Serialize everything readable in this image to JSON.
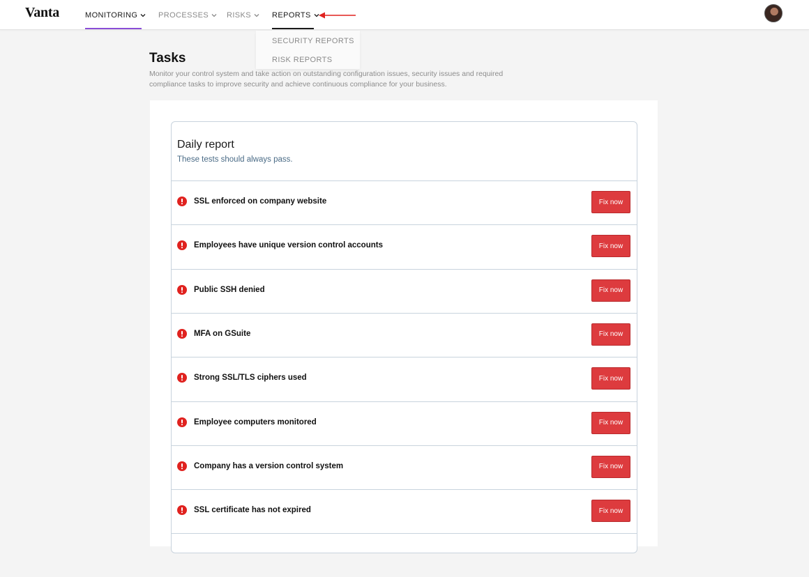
{
  "brand": {
    "logo": "Vanta"
  },
  "nav": {
    "items": [
      {
        "label": "MONITORING",
        "active": true
      },
      {
        "label": "PROCESSES",
        "active": false
      },
      {
        "label": "RISKS",
        "active": false
      },
      {
        "label": "REPORTS",
        "active": true
      }
    ],
    "dropdown": [
      "SECURITY REPORTS",
      "RISK REPORTS"
    ],
    "accent": "#8a4dd6",
    "arrow_color": "#e0221f"
  },
  "page": {
    "title": "Tasks",
    "description": "Monitor your control system and take action on outstanding configuration issues, security issues and required compliance tasks to improve security and achieve continuous compliance for your business."
  },
  "report": {
    "title": "Daily report",
    "subtitle": "These tests should always pass.",
    "button_label": "Fix now",
    "status_color": "#e0221f",
    "button_color": "#dd3b3e",
    "tests": [
      {
        "label": "SSL enforced on company website"
      },
      {
        "label": "Employees have unique version control accounts"
      },
      {
        "label": "Public SSH denied"
      },
      {
        "label": "MFA on GSuite"
      },
      {
        "label": "Strong SSL/TLS ciphers used"
      },
      {
        "label": "Employee computers monitored"
      },
      {
        "label": "Company has a version control system"
      },
      {
        "label": "SSL certificate has not expired"
      }
    ]
  }
}
